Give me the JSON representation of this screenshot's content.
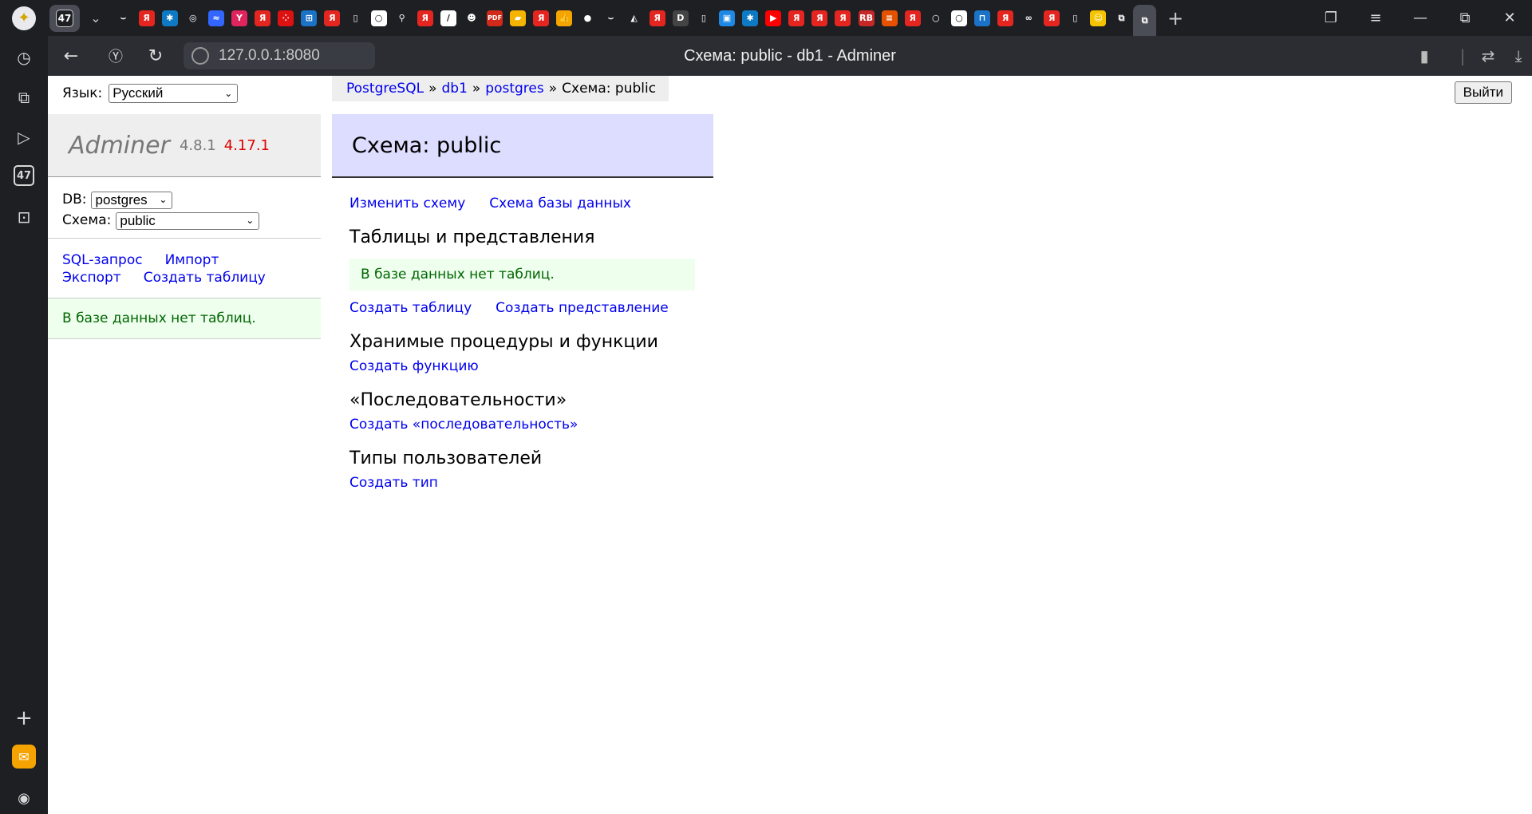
{
  "browser": {
    "tab_counter": "47",
    "url": "127.0.0.1:8080",
    "page_title": "Схема: public - db1 - Adminer",
    "pinned_tabs": [
      {
        "icon": "media-icon",
        "color": "#1d1f23",
        "glyph": "⌣"
      },
      {
        "icon": "yandex-icon",
        "color": "#e52620",
        "glyph": "Я"
      },
      {
        "icon": "puzzle-icon",
        "color": "#0f7ac4",
        "glyph": "✱"
      },
      {
        "icon": "openai-icon",
        "color": "#1d1f23",
        "glyph": "◎"
      },
      {
        "icon": "vite-icon",
        "color": "#3366ff",
        "glyph": "≈"
      },
      {
        "icon": "y-icon",
        "color": "#e0245e",
        "glyph": "Y"
      },
      {
        "icon": "yandex-icon",
        "color": "#e52620",
        "glyph": "Я"
      },
      {
        "icon": "dice-icon",
        "color": "#d11",
        "glyph": "⁘"
      },
      {
        "icon": "grid-icon",
        "color": "#1a73c7",
        "glyph": "⊞"
      },
      {
        "icon": "yandex-icon",
        "color": "#e52620",
        "glyph": "Я"
      },
      {
        "icon": "doc-icon",
        "color": "#1d1f23",
        "glyph": "▯"
      },
      {
        "icon": "circle-icon",
        "color": "#ffffff",
        "glyph": "○"
      },
      {
        "icon": "pin-icon",
        "color": "#1d1f23",
        "glyph": "⚲"
      },
      {
        "icon": "yandex-icon",
        "color": "#e52620",
        "glyph": "Я"
      },
      {
        "icon": "slash-icon",
        "color": "#ffffff",
        "glyph": "/"
      },
      {
        "icon": "face-icon",
        "color": "#1d1f23",
        "glyph": "☻"
      },
      {
        "icon": "pdf-icon",
        "color": "#d12a1b",
        "glyph": "PDF"
      },
      {
        "icon": "flag-icon",
        "color": "#f5b400",
        "glyph": "▰"
      },
      {
        "icon": "yandex-icon",
        "color": "#e52620",
        "glyph": "Я"
      },
      {
        "icon": "thumb-icon",
        "color": "#f5a400",
        "glyph": "👍"
      },
      {
        "icon": "github-icon",
        "color": "#1d1f23",
        "glyph": "●"
      },
      {
        "icon": "media-icon",
        "color": "#1d1f23",
        "glyph": "⌣"
      },
      {
        "icon": "cat-icon",
        "color": "#1d1f23",
        "glyph": "◭"
      },
      {
        "icon": "yandex-icon",
        "color": "#e52620",
        "glyph": "Я"
      },
      {
        "icon": "d-icon",
        "color": "#444",
        "glyph": "D"
      },
      {
        "icon": "doc-icon",
        "color": "#1d1f23",
        "glyph": "▯"
      },
      {
        "icon": "square-icon",
        "color": "#1e88e5",
        "glyph": "▣"
      },
      {
        "icon": "puzzle-icon",
        "color": "#0f7ac4",
        "glyph": "✱"
      },
      {
        "icon": "youtube-icon",
        "color": "#ff0000",
        "glyph": "▶"
      },
      {
        "icon": "yandex-icon",
        "color": "#e52620",
        "glyph": "Я"
      },
      {
        "icon": "yandex-icon",
        "color": "#e52620",
        "glyph": "Я"
      },
      {
        "icon": "yandex-icon",
        "color": "#e52620",
        "glyph": "Я"
      },
      {
        "icon": "rb-icon",
        "color": "#c62828",
        "glyph": "RB"
      },
      {
        "icon": "stripes-icon",
        "color": "#e65100",
        "glyph": "≡"
      },
      {
        "icon": "yandex-icon",
        "color": "#e52620",
        "glyph": "Я"
      },
      {
        "icon": "circle-icon",
        "color": "#1d1f23",
        "glyph": "○"
      },
      {
        "icon": "circle-icon",
        "color": "#ffffff",
        "glyph": "○"
      },
      {
        "icon": "chart-icon",
        "color": "#1a73c7",
        "glyph": "⊓"
      },
      {
        "icon": "yandex-icon",
        "color": "#e52620",
        "glyph": "Я"
      },
      {
        "icon": "infinity-icon",
        "color": "#1d1f23",
        "glyph": "∞"
      },
      {
        "icon": "yandex-icon",
        "color": "#e52620",
        "glyph": "Я"
      },
      {
        "icon": "doc-icon",
        "color": "#1d1f23",
        "glyph": "▯"
      },
      {
        "icon": "emoji-icon",
        "color": "#f5c400",
        "glyph": "☺"
      },
      {
        "icon": "tabs-icon",
        "color": "#1d1f23",
        "glyph": "⧉"
      },
      {
        "icon": "tabs-icon",
        "color": "#4a4d55",
        "glyph": "⧉"
      }
    ]
  },
  "adminer": {
    "lang_label": "Язык:",
    "lang_value": "Русский",
    "logout": "Выйти",
    "brand": "Adminer",
    "version": "4.8.1",
    "new_version": "4.17.1",
    "db_label": "DB:",
    "db_value": "postgres",
    "schema_label": "Схема:",
    "schema_value": "public",
    "side_links": [
      "SQL-запрос",
      "Импорт",
      "Экспорт",
      "Создать таблицу"
    ],
    "side_message": "В базе данных нет таблиц.",
    "breadcrumb": {
      "driver": "PostgreSQL",
      "server": "db1",
      "database": "postgres",
      "current": "Схема: public",
      "separator": "»"
    },
    "heading": "Схема: public",
    "top_links": [
      "Изменить схему",
      "Схема базы данных"
    ],
    "tables_heading": "Таблицы и представления",
    "tables_message": "В базе данных нет таблиц.",
    "tables_links": [
      "Создать таблицу",
      "Создать представление"
    ],
    "routines_heading": "Хранимые процедуры и функции",
    "routines_link": "Создать функцию",
    "sequences_heading": "«Последовательности»",
    "sequences_link": "Создать «последовательность»",
    "types_heading": "Типы пользователей",
    "types_link": "Создать тип"
  }
}
